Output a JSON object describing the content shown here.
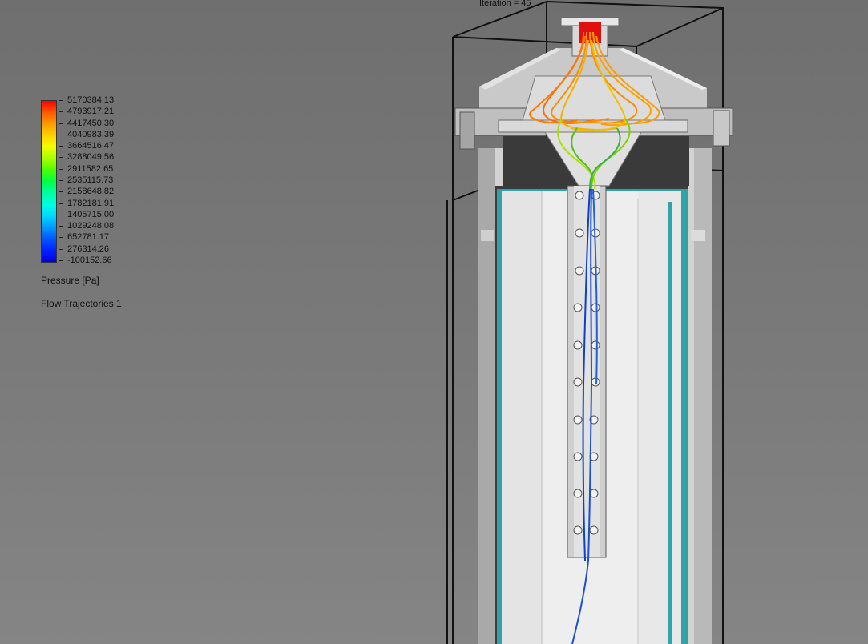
{
  "legend": {
    "ticks": [
      "5170384.13",
      "4793917.21",
      "4417450.30",
      "4040983.39",
      "3664516.47",
      "3288049.56",
      "2911582.65",
      "2535115.73",
      "2158648.82",
      "1782181.91",
      "1405715.00",
      "1029248.08",
      "652781.17",
      "276314.26",
      "-100152.66"
    ],
    "colors": [
      "#ff0000",
      "#ff5a00",
      "#ff9b00",
      "#ffd200",
      "#f0ff00",
      "#a8ff00",
      "#4cff00",
      "#00ff4a",
      "#00ffa0",
      "#00ffe0",
      "#00d8ff",
      "#0098ff",
      "#0058ff",
      "#0020ff",
      "#0000e0"
    ],
    "title": "Pressure [Pa]",
    "subtitle": "Flow Trajectories 1"
  },
  "viewport": {
    "iteration_label": "Iteration = 45"
  }
}
